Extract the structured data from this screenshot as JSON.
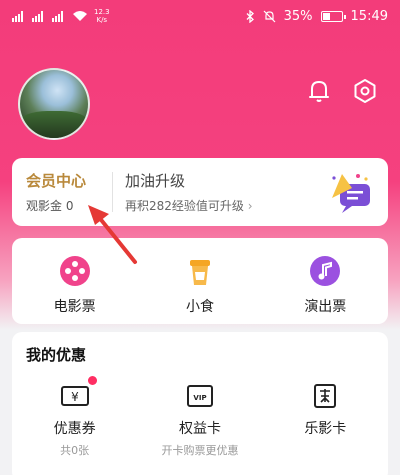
{
  "status_bar": {
    "net_speed_value": "12.3",
    "net_speed_unit": "K/s",
    "battery": "35%",
    "time": "15:49",
    "battery_level": 0.35
  },
  "header": {
    "bell_icon": "bell-icon",
    "settings_icon": "gear-icon"
  },
  "member": {
    "title": "会员中心",
    "coins": "观影金 0",
    "upgrade_title": "加油升级",
    "upgrade_desc": "再积282经验值可升级",
    "chevron": "›"
  },
  "services": [
    {
      "label": "电影票",
      "icon": "film-reel-icon",
      "color": "#f0438b"
    },
    {
      "label": "小食",
      "icon": "drink-cup-icon",
      "color": "#f5a623"
    },
    {
      "label": "演出票",
      "icon": "music-note-icon",
      "color": "#9b51e0"
    }
  ],
  "offers": {
    "title": "我的优惠",
    "items": [
      {
        "label": "优惠券",
        "sub": "共0张",
        "icon": "coupon-icon"
      },
      {
        "label": "权益卡",
        "sub": "开卡购票更优惠",
        "icon": "vip-card-icon"
      },
      {
        "label": "乐影卡",
        "sub": "",
        "icon": "film-card-icon"
      }
    ]
  },
  "colors": {
    "accent": "#f33c7a",
    "gold": "#b9893b"
  }
}
